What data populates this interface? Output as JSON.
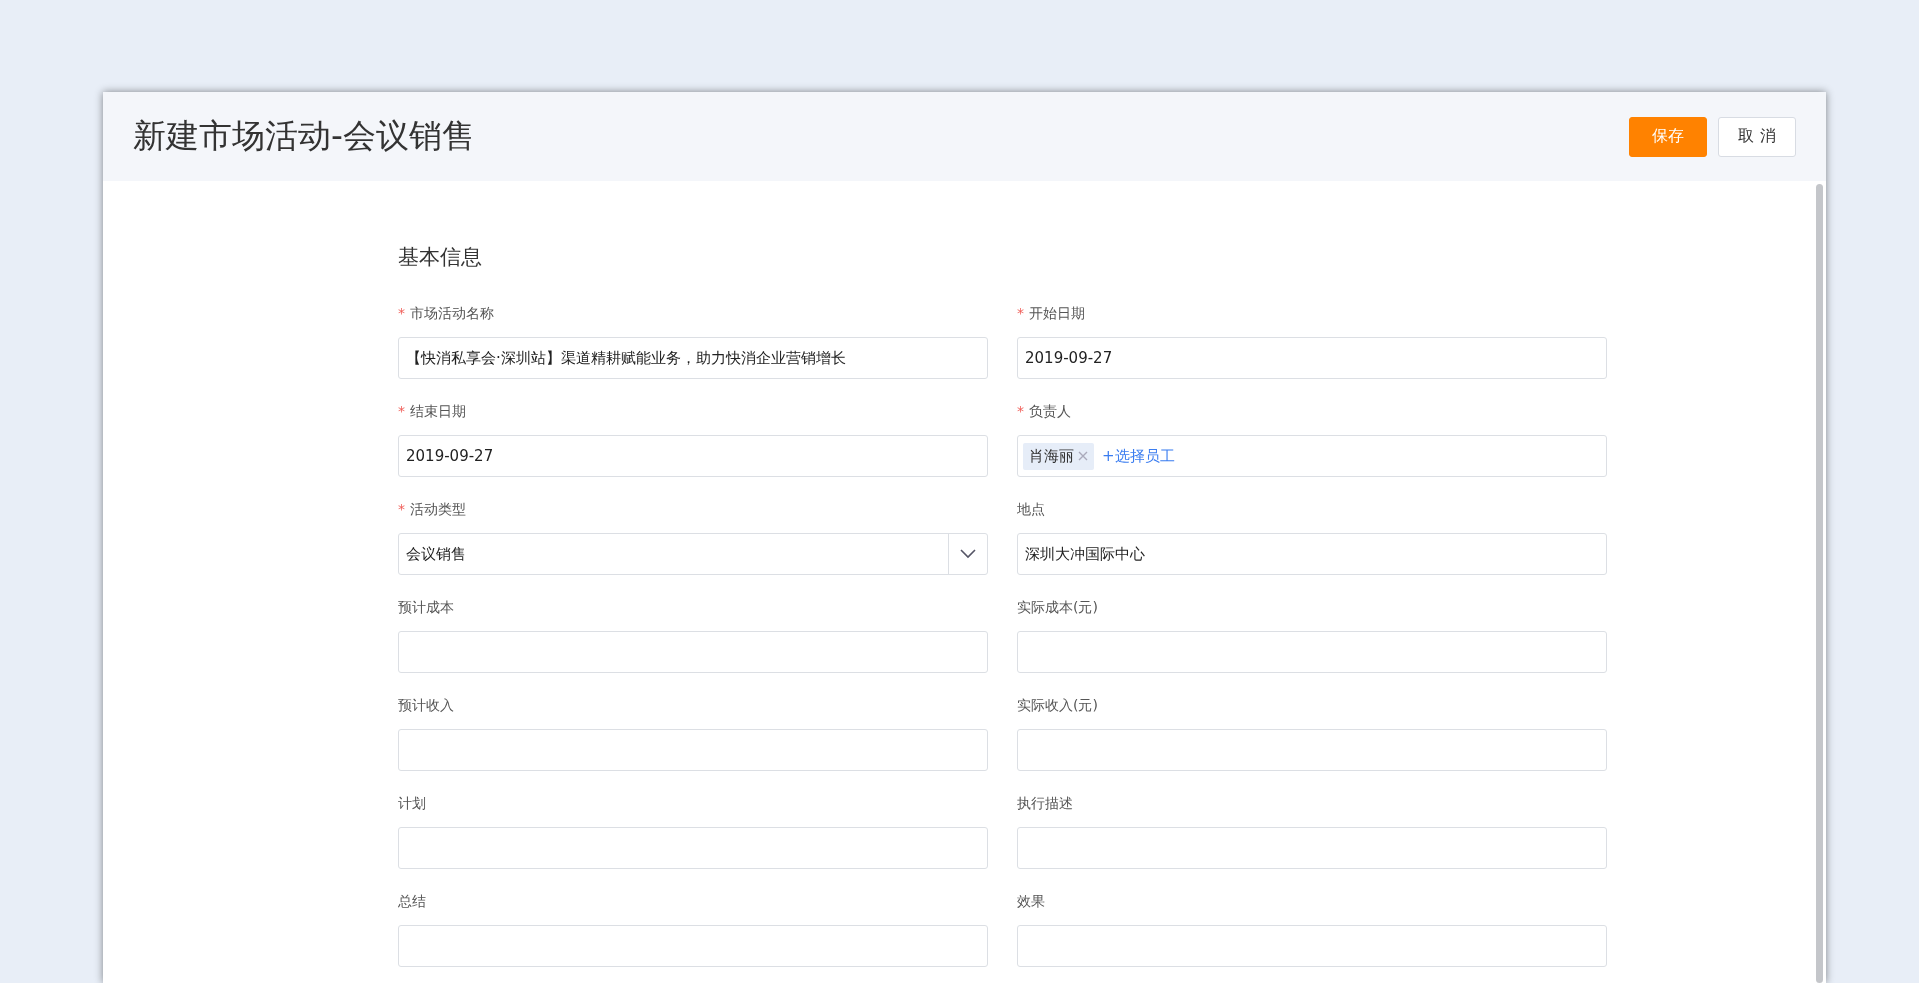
{
  "window": {
    "title": "新建市场活动-会议销售"
  },
  "buttons": [
    {
      "label": "保存",
      "kind": "primary"
    },
    {
      "label": "取 消",
      "kind": "default"
    }
  ],
  "section": {
    "title": "基本信息"
  },
  "fields": [
    {
      "required_mark": "*",
      "label": "市场活动名称",
      "kind": "text",
      "value": "【快消私享会·深圳站】渠道精耕赋能业务，助力快消企业营销增长"
    },
    {
      "required_mark": "*",
      "label": "开始日期",
      "kind": "text",
      "value": "2019-09-27"
    },
    {
      "required_mark": "*",
      "label": "结束日期",
      "kind": "text",
      "value": "2019-09-27"
    },
    {
      "required_mark": "*",
      "label": "负责人",
      "kind": "people",
      "tags": [
        "肖海丽"
      ],
      "add_label": "+选择员工"
    },
    {
      "required_mark": "*",
      "label": "活动类型",
      "kind": "select",
      "value": "会议销售"
    },
    {
      "label": "地点",
      "kind": "text",
      "value": "深圳大冲国际中心"
    },
    {
      "label": "预计成本",
      "kind": "text"
    },
    {
      "label": "实际成本(元)",
      "kind": "text"
    },
    {
      "label": "预计收入",
      "kind": "text"
    },
    {
      "label": "实际收入(元)",
      "kind": "text"
    },
    {
      "label": "计划",
      "kind": "text"
    },
    {
      "label": "执行描述",
      "kind": "text"
    },
    {
      "label": "总结",
      "kind": "text"
    },
    {
      "label": "效果",
      "kind": "text"
    }
  ]
}
